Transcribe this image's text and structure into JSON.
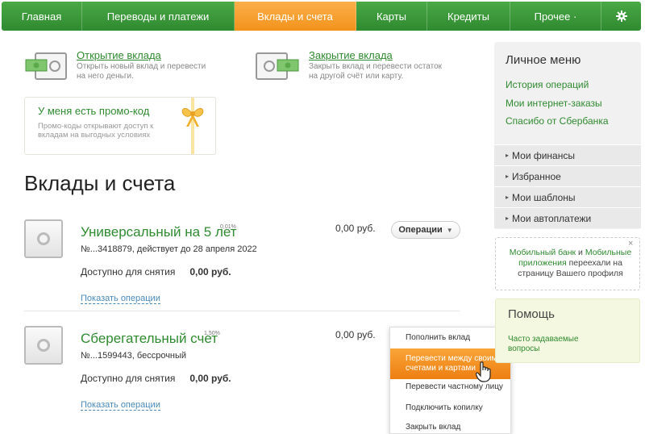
{
  "nav": {
    "items": [
      "Главная",
      "Переводы и платежи",
      "Вклады и счета",
      "Карты",
      "Кредиты",
      "Прочее ·"
    ],
    "active": "Вклады и счета",
    "settings_icon": "gear-icon"
  },
  "quick_actions": [
    {
      "title": "Открытие вклада",
      "desc_line1": "Открыть новый вклад и перевести",
      "desc_line2": "на него деньги."
    },
    {
      "title": "Закрытие вклада",
      "desc_line1": "Закрыть вклад и перевести остаток",
      "desc_line2": "на другой счёт или карту."
    }
  ],
  "promo": {
    "title": "У меня есть промо-код",
    "desc_line1": "Промо-коды открывают доступ к",
    "desc_line2": "вкладам на выгодных условиях"
  },
  "page_title": "Вклады и счета",
  "deposits": [
    {
      "name": "Универсальный на 5 лет",
      "rate": "0,01%",
      "number": "№...3418879, действует до 28 апреля 2022",
      "amount": "0,00 руб.",
      "available_label": "Доступно для снятия",
      "available_value": "0,00 руб.",
      "show_ops": "Показать операции",
      "ops_button": "Операции"
    },
    {
      "name": "Сберегательный счет",
      "rate": "1,50%",
      "number": "№...1599443, бессрочный",
      "amount": "0,00 руб.",
      "available_label": "Доступно для снятия",
      "available_value": "0,00 руб.",
      "show_ops": "Показать операции"
    }
  ],
  "dropdown": {
    "items": [
      {
        "line1": "Пополнить вклад"
      },
      {
        "line1": "Перевести между своими",
        "line2": "счетами и картами",
        "active": true
      },
      {
        "line1": "Перевести частному лицу"
      },
      {
        "line1": "Подключить копилку"
      },
      {
        "line1": "Закрыть вклад"
      }
    ]
  },
  "personal_menu": {
    "title": "Личное меню",
    "links": [
      "История операций",
      "Мои интернет-заказы",
      "Спасибо от Сбербанка"
    ],
    "sections": [
      "Мои финансы",
      "Избранное",
      "Мои шаблоны",
      "Мои автоплатежи"
    ]
  },
  "notice": {
    "part1": "Мобильный банк",
    "part2": " и ",
    "part3": "Мобильные приложения",
    "part4": " переехали на страницу Вашего профиля",
    "close": "×"
  },
  "help": {
    "title": "Помощь",
    "link": "Часто задаваемые вопросы"
  },
  "colors": {
    "brand_green": "#2f8a30",
    "accent_orange": "#f3921c"
  }
}
